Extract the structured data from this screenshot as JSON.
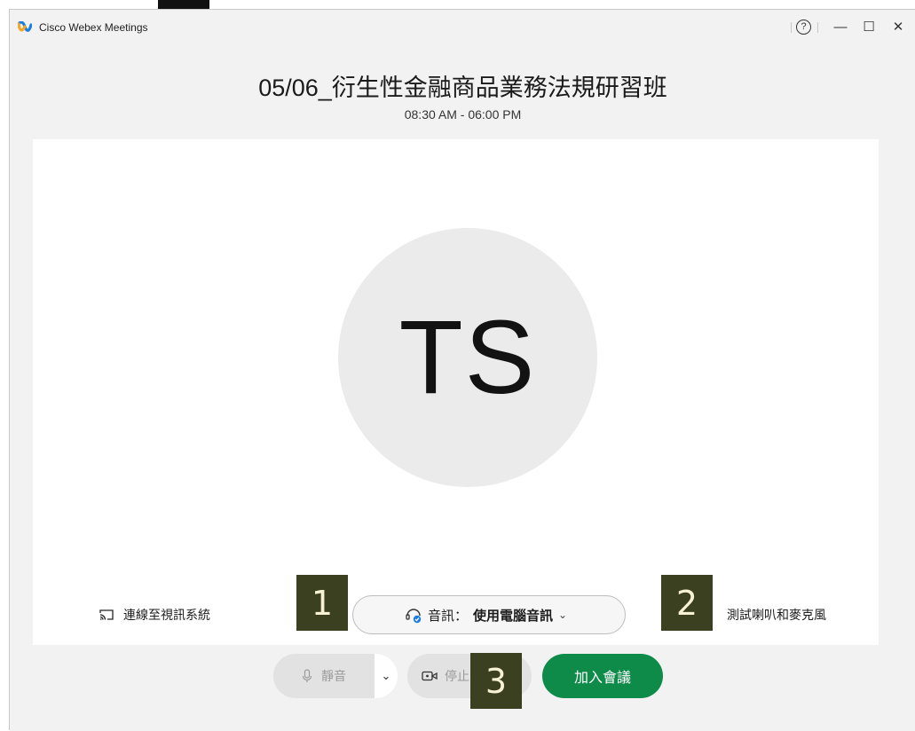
{
  "window": {
    "app_name": "Cisco Webex Meetings",
    "help_glyph": "?",
    "minimize_glyph": "—",
    "maximize_glyph": "☐",
    "close_glyph": "✕"
  },
  "meeting": {
    "title": "05/06_衍生性金融商品業務法規研習班",
    "time": "08:30 AM - 06:00 PM",
    "avatar_initials": "TS"
  },
  "controls": {
    "video_system_link": "連線至視訊系統",
    "audio_label": "音訊：",
    "audio_value": "使用電腦音訊",
    "audio_chevron": "⌄",
    "test_speaker": "測試喇叭和麥克風",
    "mute_label": "靜音",
    "mute_chevron": "⌄",
    "video_label": "停止",
    "join_label": "加入會議"
  },
  "markers": [
    "1",
    "2",
    "3"
  ],
  "colors": {
    "join_green": "#0e8a49",
    "marker_bg": "#3b4021",
    "marker_text": "#f7f2d4",
    "window_bg": "#f2f2f2",
    "avatar_bg": "#ebebeb"
  },
  "icons": {
    "app_logo": "webex-logo-icon",
    "help": "help-icon",
    "cast": "cast-icon",
    "headset": "headset-icon",
    "mic": "microphone-icon",
    "camera": "camera-icon"
  }
}
